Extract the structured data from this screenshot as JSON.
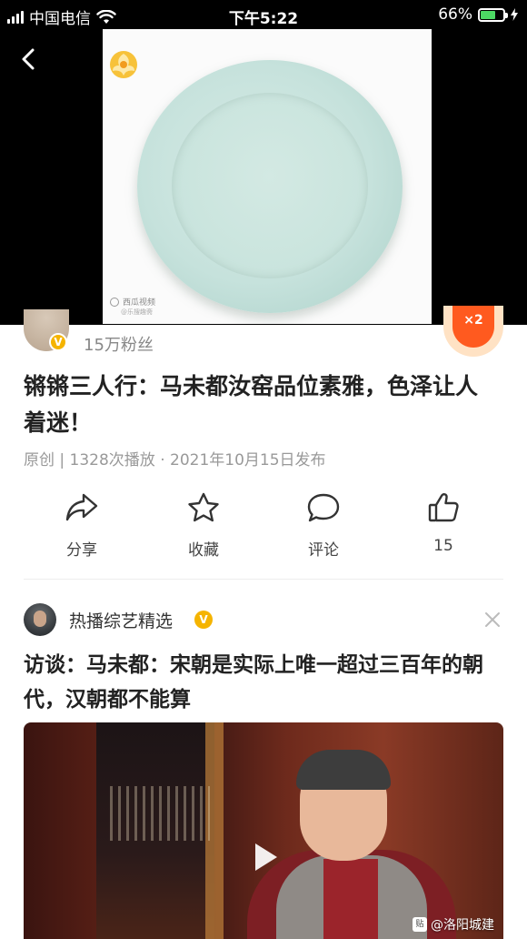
{
  "status_bar": {
    "carrier": "中国电信",
    "time": "下午5:22",
    "battery_percent": "66%",
    "battery_level": 0.66
  },
  "video": {
    "watermark": "西瓜视频",
    "watermark_sub": "@乐搜趣斋"
  },
  "author": {
    "fans": "15万粉丝",
    "verified_icon": "verified-v-icon"
  },
  "article": {
    "title": "锵锵三人行：马未都汝窑品位素雅，色泽让人着迷！",
    "meta": "原创 | 1328次播放 · 2021年10月15日发布"
  },
  "actions": [
    {
      "icon": "share-icon",
      "label": "分享"
    },
    {
      "icon": "star-icon",
      "label": "收藏"
    },
    {
      "icon": "comment-icon",
      "label": "评论"
    },
    {
      "icon": "thumbs-up-icon",
      "label": "15"
    }
  ],
  "related": {
    "channel_name": "热播综艺精选",
    "title": "访谈：马未都：宋朝是实际上唯一超过三百年的朝代，汉朝都不能算",
    "thumb_watermark": "@洛阳城建",
    "thumb_watermark_icon": "贴"
  },
  "colors": {
    "accent_orange": "#ff5a1f",
    "verify_gold": "#f5b400",
    "meta_gray": "#999999",
    "battery_green": "#4cd964"
  }
}
